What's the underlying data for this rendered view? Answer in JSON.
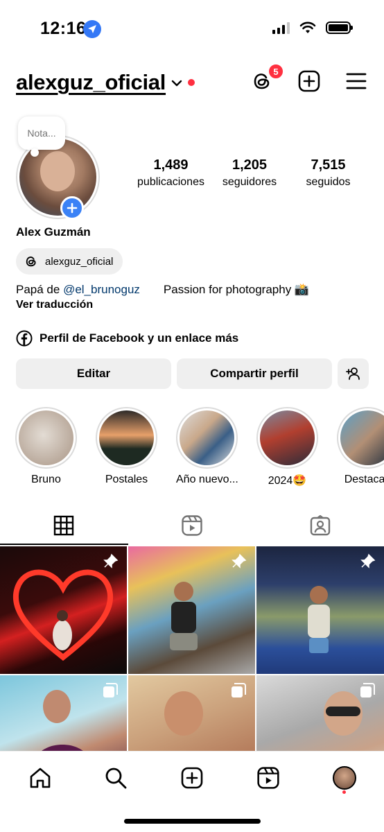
{
  "status_bar": {
    "time": "12:16"
  },
  "header": {
    "username": "alexguz_oficial",
    "notification_count": "5"
  },
  "profile": {
    "note_placeholder": "Nota...",
    "display_name": "Alex Guzmán",
    "threads_handle": "alexguz_oficial",
    "bio_prefix": "Papá de ",
    "bio_mention": "@el_brunoguz",
    "bio_suffix": "Passion for photography 📸",
    "translate_label": "Ver traducción",
    "link_text": "Perfil de Facebook y un enlace más"
  },
  "stats": [
    {
      "value": "1,489",
      "label": "publicaciones"
    },
    {
      "value": "1,205",
      "label": "seguidores"
    },
    {
      "value": "7,515",
      "label": "seguidos"
    }
  ],
  "buttons": {
    "edit": "Editar",
    "share": "Compartir perfil"
  },
  "highlights": [
    {
      "label": "Bruno",
      "colors": [
        "#e3dcd4",
        "#a89484"
      ]
    },
    {
      "label": "Postales",
      "colors": [
        "#e7a06a",
        "#1e2a22"
      ]
    },
    {
      "label": "Año nuevo...",
      "colors": [
        "#c9a88a",
        "#3a5f87"
      ]
    },
    {
      "label": "2024🤩",
      "colors": [
        "#b13f2f",
        "#2c2c3a"
      ]
    },
    {
      "label": "Destacad",
      "colors": [
        "#5aa0c8",
        "#b28f75"
      ]
    }
  ],
  "tabs": [
    "grid-icon",
    "reels-icon",
    "tagged-icon"
  ],
  "posts": [
    {
      "kind": "pin",
      "bg": "linear-gradient(160deg,#1a0a0a 0%,#3b0b0b 40%,#d42020 55%,#2a0707 75%,#0b0b0b 100%)"
    },
    {
      "kind": "pin",
      "bg": "linear-gradient(160deg,#e96aa0 0%,#e8c15a 25%,#6aa0c0 50%,#5b4a3a 75%,#a9a9a9 100%)"
    },
    {
      "kind": "pin",
      "bg": "linear-gradient(180deg,#1c2540 0%,#2d3f6b 30%,#8a9a6a 55%,#2b4f9a 80%,#203a7a 100%)"
    },
    {
      "kind": "multi",
      "bg": "linear-gradient(160deg,#7cc6dc 0%,#bfe3ec 40%,#c08a70 60%,#3b1030 100%)"
    },
    {
      "kind": "multi",
      "bg": "linear-gradient(160deg,#e2c9a0 0%,#caa07b 40%,#b57c5c 70%,#2b2b2b 100%)"
    },
    {
      "kind": "multi",
      "bg": "linear-gradient(160deg,#dadada 0%,#a9a9a9 40%,#c9a289 65%,#e0e0d0 100%)"
    }
  ]
}
